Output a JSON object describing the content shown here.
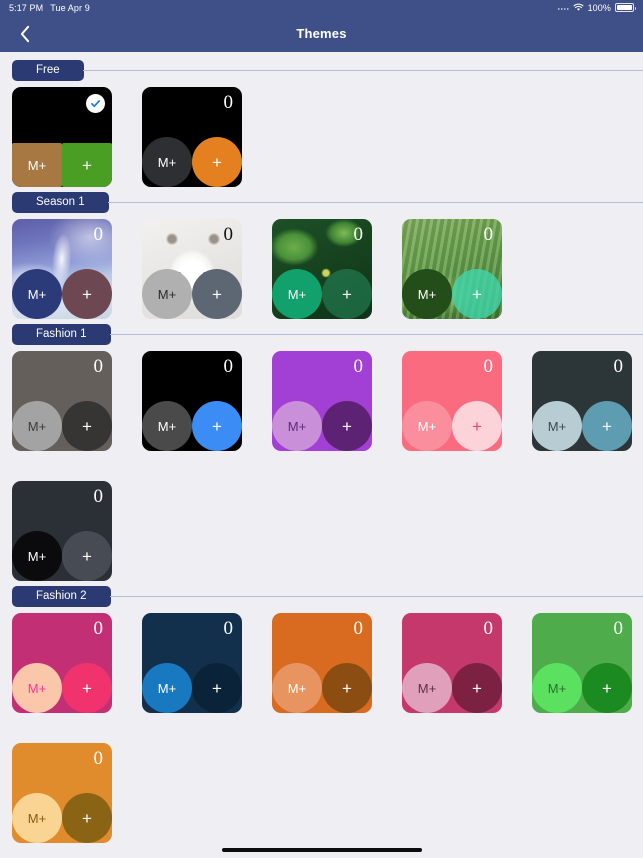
{
  "statusbar": {
    "time": "5:17 PM",
    "date": "Tue Apr 9",
    "battery_percent": "100%",
    "wifi_icon": "wifi-icon",
    "battery_icon": "battery-icon",
    "signal_icon": "signal-dots-icon"
  },
  "navbar": {
    "back_icon": "chevron-left-icon",
    "title": "Themes",
    "background": "#3f5088"
  },
  "card_labels": {
    "memory_button": "M+",
    "add_button": "+",
    "display_value": "0",
    "selected_icon": "check-icon"
  },
  "sections": [
    {
      "title": "Free",
      "themes": [
        {
          "name": "black-brown-green",
          "selected": true,
          "bg": "#000000",
          "zero_color": "#ffffff",
          "shape": "square",
          "m_bg": "#a87843",
          "m_fg": "#ffffff",
          "p_bg": "#4a9e24",
          "p_fg": "#ffffff"
        },
        {
          "name": "black-orange",
          "selected": false,
          "bg": "#000000",
          "zero_color": "#ffffff",
          "shape": "circle",
          "m_bg": "#2d2f33",
          "m_fg": "#ffffff",
          "p_bg": "#e4801f",
          "p_fg": "#ffffff"
        }
      ]
    },
    {
      "title": "Season 1",
      "themes": [
        {
          "name": "winter-snow-photo",
          "selected": false,
          "photo": "ph-snow",
          "zero_color": "#ffffff",
          "shape": "circle",
          "m_bg": "#2b3b79",
          "m_fg": "#ffffff",
          "p_bg": "#6d4852",
          "p_fg": "#ffffff"
        },
        {
          "name": "arctic-fox-photo",
          "selected": false,
          "photo": "ph-fox",
          "zero_color": "#111111",
          "shape": "circle",
          "m_bg": "#b0b0b0",
          "m_fg": "#2b2b2b",
          "p_bg": "#5d6673",
          "p_fg": "#ffffff"
        },
        {
          "name": "green-leaf-photo",
          "selected": false,
          "photo": "ph-leaf",
          "zero_color": "#ffffff",
          "shape": "circle",
          "m_bg": "#12a06c",
          "m_fg": "#ffffff",
          "p_bg": "rgba(38,140,95,0.55)",
          "p_fg": "#ffffff"
        },
        {
          "name": "rice-terrace-photo",
          "selected": false,
          "photo": "ph-terrace",
          "zero_color": "#ffffff",
          "shape": "circle",
          "m_bg": "#234d19",
          "m_fg": "#ffffff",
          "p_bg": "rgba(64,214,170,0.80)",
          "p_fg": "#ffffff"
        }
      ]
    },
    {
      "title": "Fashion 1",
      "themes": [
        {
          "name": "gray-mono",
          "selected": false,
          "bg": "#645f5b",
          "zero_color": "#ffffff",
          "shape": "circle",
          "m_bg": "#a3a3a3",
          "m_fg": "#3b3b3b",
          "p_bg": "#373534",
          "p_fg": "#ffffff"
        },
        {
          "name": "black-bright-blue",
          "selected": false,
          "bg": "#000000",
          "zero_color": "#ffffff",
          "shape": "circle",
          "m_bg": "#4a4a4a",
          "m_fg": "#ffffff",
          "p_bg": "#3b8cf5",
          "p_fg": "#ffffff"
        },
        {
          "name": "purple-violet",
          "selected": false,
          "bg": "#a23fd4",
          "zero_color": "#ffffff",
          "shape": "circle",
          "m_bg": "#c98fd9",
          "m_fg": "#5e2a7a",
          "p_bg": "#5e2275",
          "p_fg": "#ffffff"
        },
        {
          "name": "coral-pink",
          "selected": false,
          "bg": "#fb6b7f",
          "zero_color": "#ffffff",
          "shape": "circle",
          "m_bg": "#fb8e9d",
          "m_fg": "#ffffff",
          "p_bg": "#fcd3d8",
          "p_fg": "#f0426f"
        },
        {
          "name": "dark-slate-teal",
          "selected": false,
          "bg": "#2c3538",
          "zero_color": "#ffffff",
          "shape": "circle",
          "m_bg": "#b7ccd3",
          "m_fg": "#3b4b50",
          "p_bg": "#5e9cb1",
          "p_fg": "#ffffff"
        },
        {
          "name": "charcoal-gray",
          "selected": false,
          "bg": "#2b2f36",
          "zero_color": "#ffffff",
          "shape": "circle",
          "m_bg": "#0b0b0d",
          "m_fg": "#ffffff",
          "p_bg": "#474c54",
          "p_fg": "#ffffff"
        }
      ]
    },
    {
      "title": "Fashion 2",
      "themes": [
        {
          "name": "magenta-blush",
          "selected": false,
          "bg": "#c22f74",
          "zero_color": "#ffffff",
          "shape": "circle",
          "m_bg": "#fbc7aa",
          "m_fg": "#ff3399",
          "p_bg": "#f0336c",
          "p_fg": "#ffffff"
        },
        {
          "name": "navy-blue",
          "selected": false,
          "bg": "#12304c",
          "zero_color": "#ffffff",
          "shape": "circle",
          "m_bg": "#1878c0",
          "m_fg": "#ffffff",
          "p_bg": "#0b2338",
          "p_fg": "#ffffff"
        },
        {
          "name": "orange-burnt",
          "selected": false,
          "bg": "#d96b20",
          "zero_color": "#ffffff",
          "shape": "circle",
          "m_bg": "#e89461",
          "m_fg": "#ffffff",
          "p_bg": "#8b4d12",
          "p_fg": "#ffffff"
        },
        {
          "name": "rose-crimson",
          "selected": false,
          "bg": "#c4386c",
          "zero_color": "#ffffff",
          "shape": "circle",
          "m_bg": "#e0a0bb",
          "m_fg": "#5c3048",
          "p_bg": "#7d2142",
          "p_fg": "#ffffff"
        },
        {
          "name": "green-meadow",
          "selected": false,
          "bg": "#4eac4b",
          "zero_color": "#ffffff",
          "shape": "circle",
          "m_bg": "#5ce060",
          "m_fg": "#28702a",
          "p_bg": "#1b8a20",
          "p_fg": "#ffffff"
        },
        {
          "name": "amber-gold",
          "selected": false,
          "bg": "#e08b2c",
          "zero_color": "#ffffff",
          "shape": "circle",
          "m_bg": "#f9d493",
          "m_fg": "#8a5a12",
          "p_bg": "#8a6414",
          "p_fg": "#ffffff"
        }
      ]
    }
  ],
  "home_indicator": "home-indicator"
}
